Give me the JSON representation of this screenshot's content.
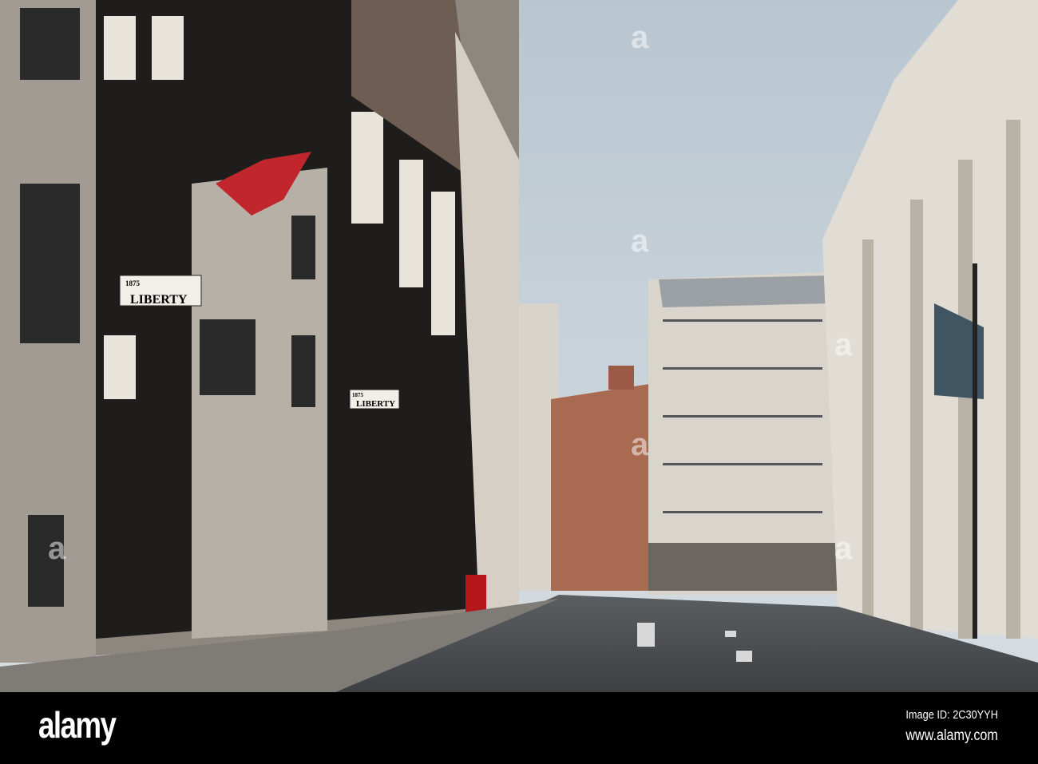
{
  "photo": {
    "signs": {
      "liberty_upper": "LIBERTY",
      "liberty_upper_year": "1875",
      "liberty_lower": "LIBERTY",
      "liberty_lower_year": "1875"
    },
    "watermark": "a"
  },
  "footer": {
    "brand": "alamy",
    "image_id": "Image ID: 2C30YYH",
    "url": "www.alamy.com"
  }
}
